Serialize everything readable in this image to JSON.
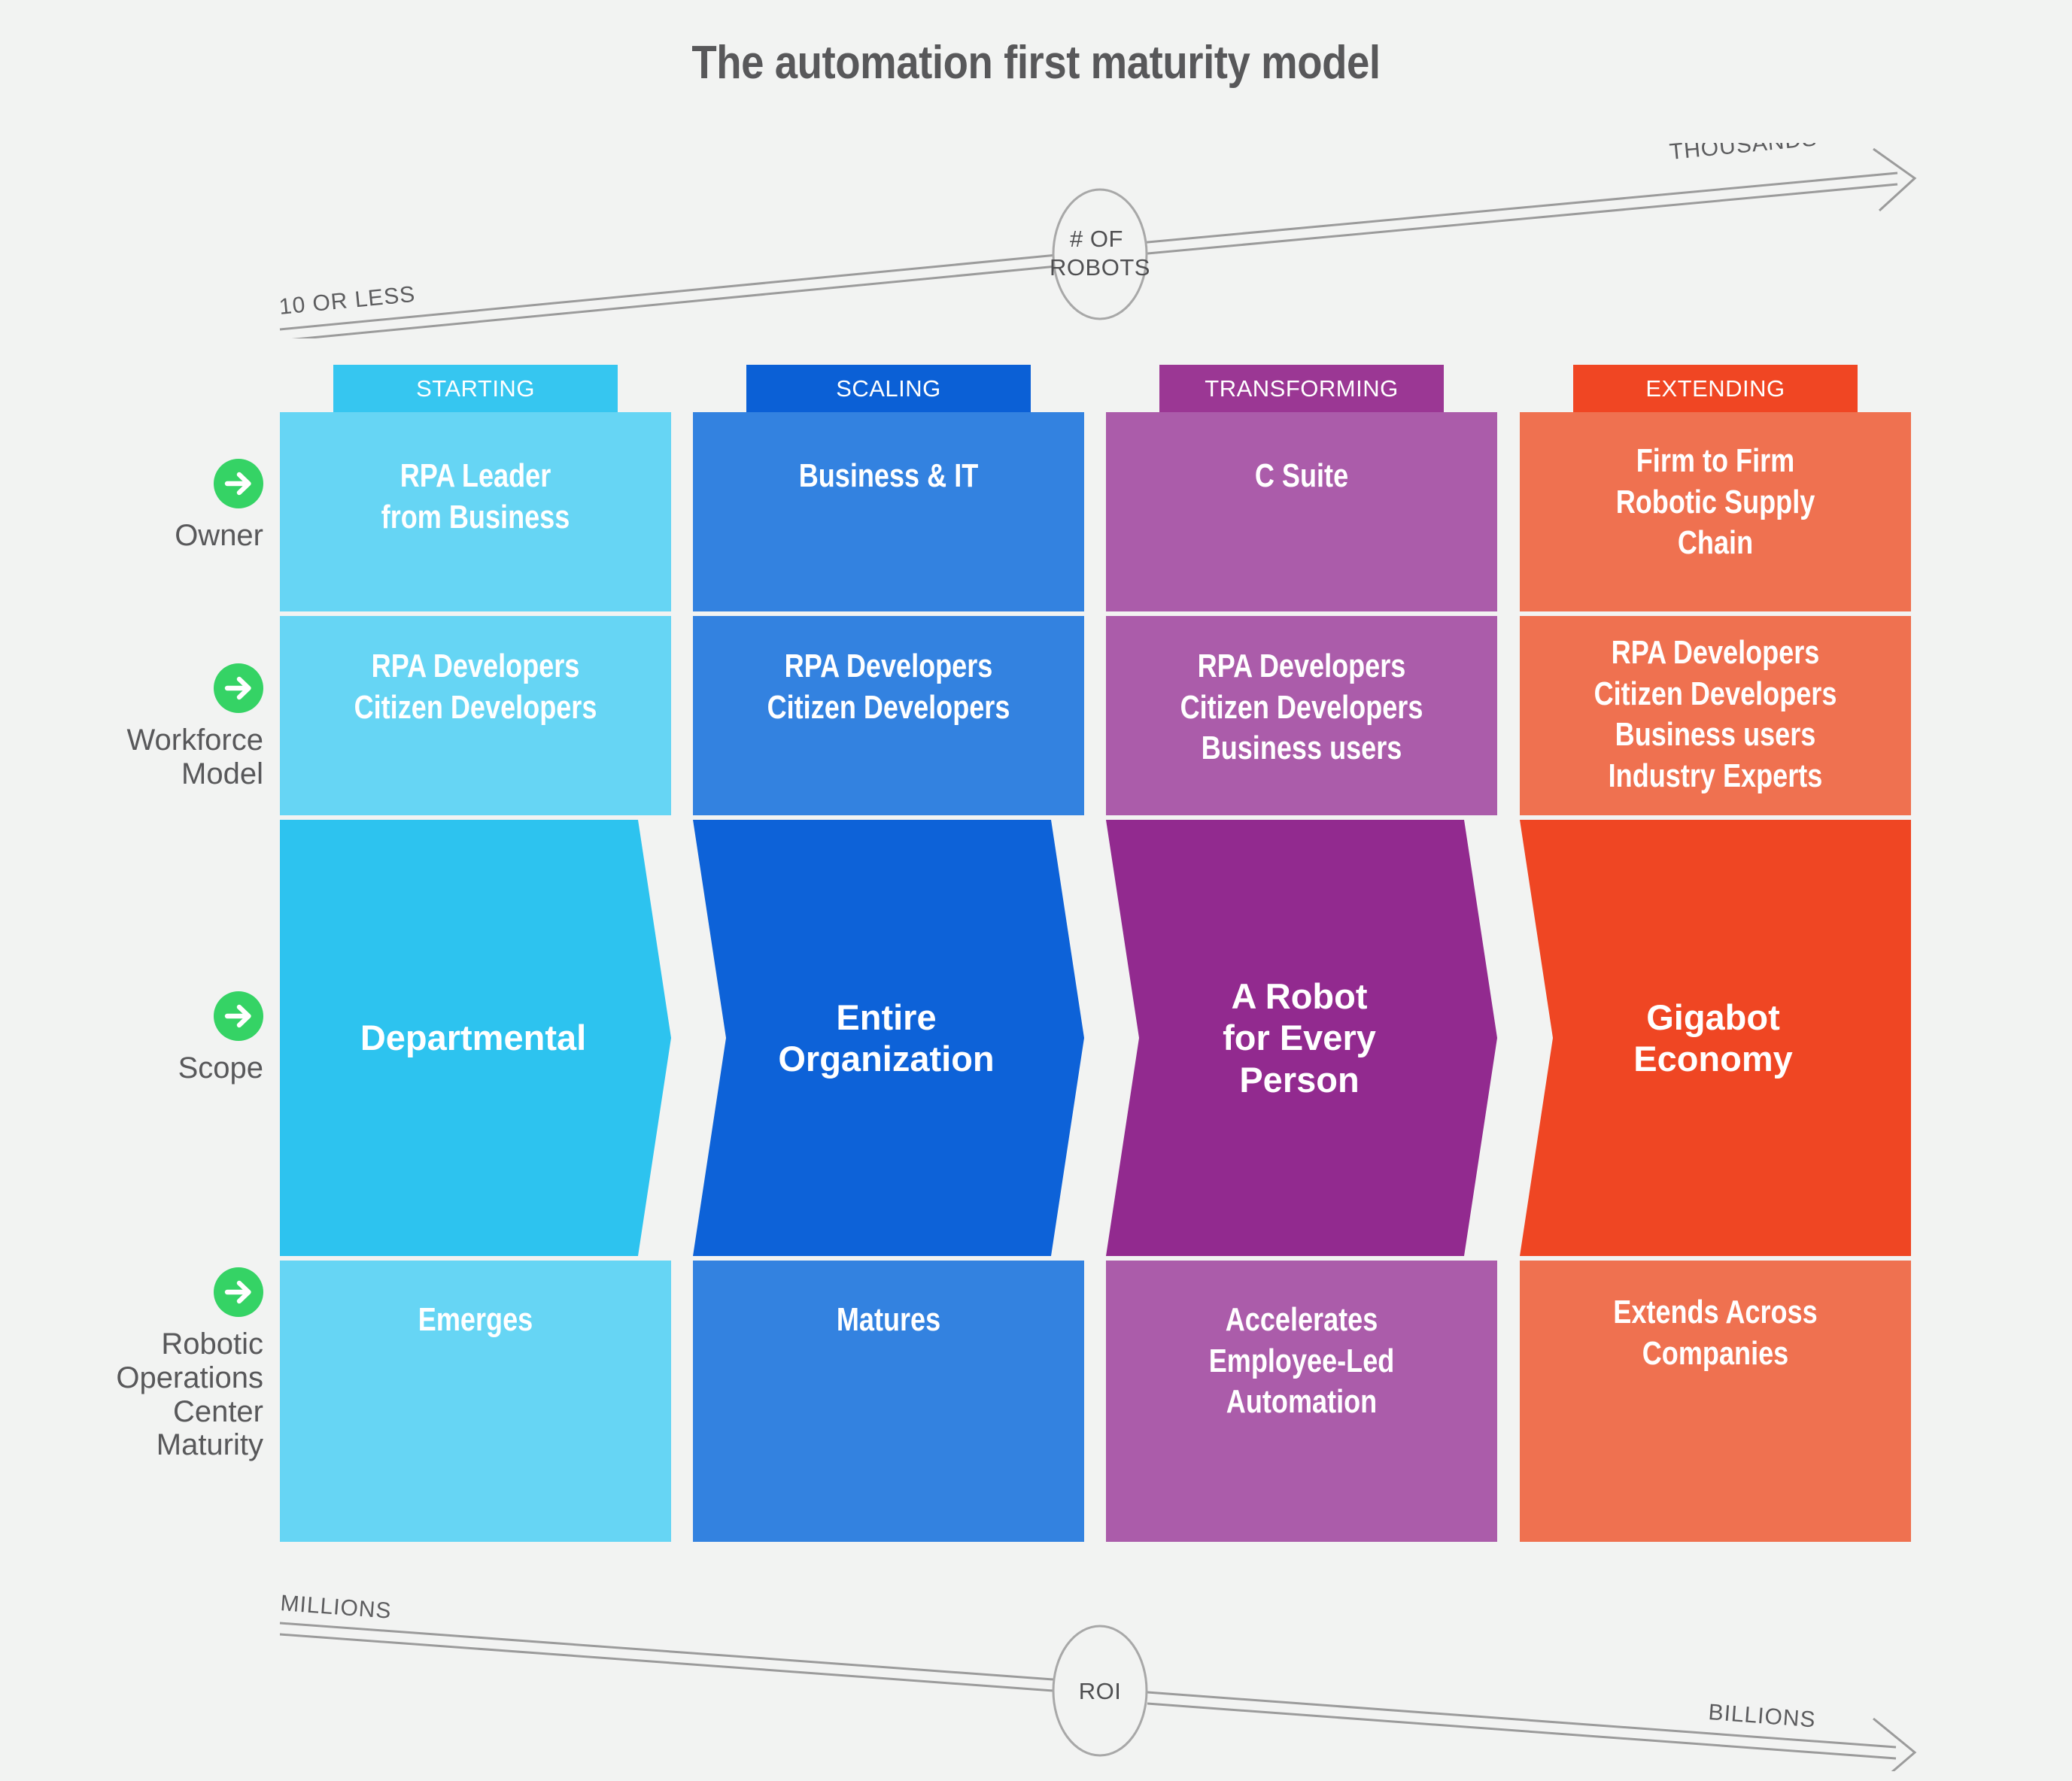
{
  "title": "The automation first maturity model",
  "colors": {
    "background": "#f2f3f2",
    "title_text": "#58585a",
    "bullet_green": "#35d365",
    "axis_gray": "#9b9b9b",
    "axis_text": "#5c5c5e",
    "starting_header": "#36c6f0",
    "starting_light": "#66d5f4",
    "starting_strong": "#2dc3ef",
    "scaling_header": "#0b60d6",
    "scaling_light": "#3382e0",
    "scaling_strong": "#0d62d8",
    "transforming_header": "#9b3794",
    "transforming_light": "#ab5caa",
    "transforming_strong": "#922a8f",
    "extending_header": "#f04623",
    "extending_light": "#ef7150",
    "extending_strong": "#ef4623"
  },
  "top_axis": {
    "hub_label": "# OF\nROBOTS",
    "left_label": "10 OR LESS",
    "right_label": "THOUSANDS"
  },
  "bottom_axis": {
    "hub_label": "ROI",
    "left_label": "MILLIONS",
    "right_label": "BILLIONS"
  },
  "row_labels": [
    {
      "caption": "Owner",
      "icon": "arrow-right-icon"
    },
    {
      "caption": "Workforce\nModel",
      "icon": "arrow-right-icon"
    },
    {
      "caption": "Scope",
      "icon": "arrow-right-icon"
    },
    {
      "caption": "Robotic\nOperations\nCenter\nMaturity",
      "icon": "arrow-right-icon"
    }
  ],
  "columns": [
    {
      "header": "STARTING",
      "cells": {
        "owner": "RPA Leader\nfrom Business",
        "workforce": "RPA Developers\nCitizen Developers",
        "scope": "Departmental",
        "roc": "Emerges"
      }
    },
    {
      "header": "SCALING",
      "cells": {
        "owner": "Business & IT",
        "workforce": "RPA Developers\nCitizen Developers",
        "scope": "Entire\nOrganization",
        "roc": "Matures"
      }
    },
    {
      "header": "TRANSFORMING",
      "cells": {
        "owner": "C Suite",
        "workforce": "RPA Developers\nCitizen Developers\nBusiness users",
        "scope": "A Robot\nfor Every\nPerson",
        "roc": "Accelerates\nEmployee-Led\nAutomation"
      }
    },
    {
      "header": "EXTENDING",
      "cells": {
        "owner": "Firm to Firm\nRobotic Supply\nChain",
        "workforce": "RPA Developers\nCitizen Developers\nBusiness users\nIndustry Experts",
        "scope": "Gigabot\nEconomy",
        "roc": "Extends Across\nCompanies"
      }
    }
  ]
}
